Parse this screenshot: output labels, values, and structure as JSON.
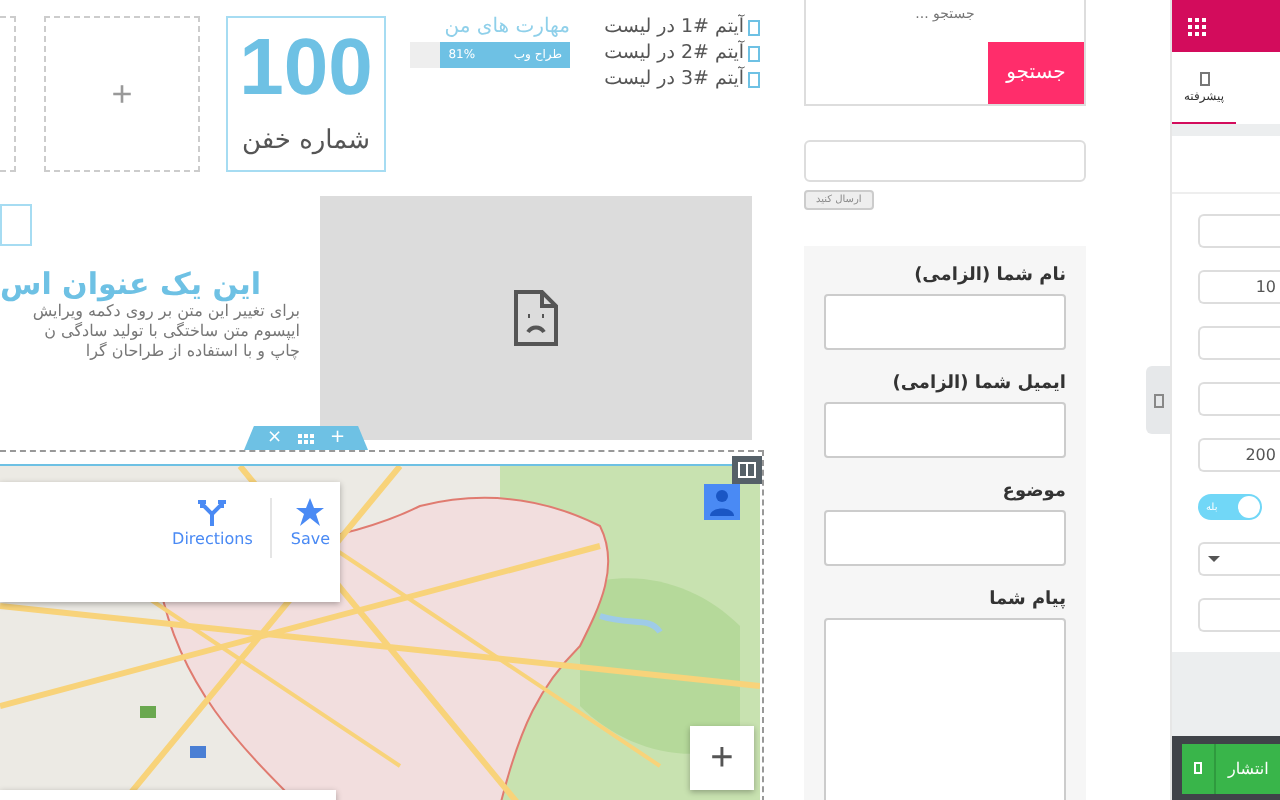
{
  "canvas": {
    "placeholder_button": "+",
    "counter": {
      "number": "100",
      "title": "شماره خفن"
    },
    "skills": {
      "title": "مهارت های من",
      "bars": [
        {
          "label": "طراح وب",
          "reading": "81%",
          "level": 0.81
        }
      ]
    },
    "list": [
      {
        "text": "آیتم #1 در لیست"
      },
      {
        "text": "آیتم #2 در لیست"
      },
      {
        "text": "آیتم #3 در لیست"
      }
    ],
    "feature": {
      "heading": "این یک عنوان اس",
      "lines": [
        "برای تغییر این متن بر روی دکمه ویرایش",
        "ایپسوم متن ساختگی با تولید سادگی ن",
        "چاپ و با استفاده از طراحان گرا"
      ]
    },
    "section_handle": {
      "close": "×",
      "add": "+"
    },
    "map": {
      "kind": "picture",
      "actions": [
        {
          "label": "Save",
          "kind": "save"
        },
        {
          "label": "Directions",
          "kind": "directions"
        }
      ],
      "zoom_in": "+"
    }
  },
  "sidebar": {
    "search": {
      "placeholder": "جستجو ...",
      "button": "جستجو"
    },
    "newsletter": {
      "button": "ارسال کنید"
    },
    "form": {
      "fields": [
        {
          "label": "نام شما (الزامی)",
          "kind": "input"
        },
        {
          "label": "ایمیل شما (الزامی)",
          "kind": "input"
        },
        {
          "label": "موضوع",
          "kind": "input"
        },
        {
          "label": "پیام شما",
          "kind": "textarea"
        }
      ]
    }
  },
  "panel": {
    "tabs": [
      {
        "label": "پیشرفته",
        "selected": true
      }
    ],
    "controls": [
      {
        "kind": "input"
      },
      {
        "kind": "input",
        "value": "10"
      },
      {
        "kind": "input"
      },
      {
        "kind": "input"
      },
      {
        "kind": "input",
        "value": "200"
      },
      {
        "kind": "switch",
        "label": "بله",
        "on": true
      },
      {
        "kind": "select"
      },
      {
        "kind": "input"
      }
    ],
    "publish_button": "انتشار"
  }
}
